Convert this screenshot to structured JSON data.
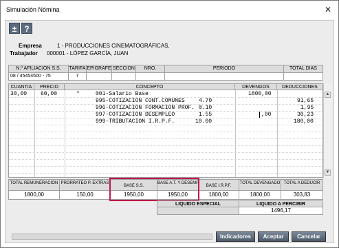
{
  "window": {
    "title": "Simulación Nómina",
    "close_glyph": "✕"
  },
  "toolbar": {
    "plusminus": "±",
    "help": "?"
  },
  "header": {
    "empresa_label": "Empresa",
    "empresa_value": "1  - PRODUCCIONES CINEMATOGRÁFICAS,",
    "trabajador_label": "Trabajador",
    "trabajador_value": "000001 - LÓPEZ GARCÍA, JUAN"
  },
  "afiliacion": {
    "headers": [
      "N.º AFILIACION S.S.",
      "TARIFA",
      "EPIGRAFE",
      "SECCION",
      "NRO.",
      "PERIODO",
      "TOTAL DIAS"
    ],
    "values": [
      "08 / 45454500 - 75",
      "7",
      "",
      "",
      "",
      "",
      ""
    ]
  },
  "lines": {
    "headers": [
      "CUANTIA",
      "PRECIO",
      "CONCEPTO",
      "DEVENGOS",
      "DEDUCCIONES"
    ],
    "rows": [
      {
        "cuantia": "30,00",
        "precio": "60,00",
        "mark": "*",
        "concepto": "001-Salario Base",
        "pct": "",
        "devengos": "1800,00",
        "deducciones": ""
      },
      {
        "cuantia": "",
        "precio": "",
        "mark": "",
        "concepto": "995-COTIZACION CONT.COMUNES",
        "pct": "4.70",
        "devengos": "",
        "deducciones": "91,65"
      },
      {
        "cuantia": "",
        "precio": "",
        "mark": "",
        "concepto": "996-COTIZACION FORMACION PROF.",
        "pct": "0.10",
        "devengos": "",
        "deducciones": "1,95"
      },
      {
        "cuantia": "",
        "precio": "",
        "mark": "",
        "concepto": "997-COTIZACION DESEMPLEO",
        "pct": "1.55",
        "devengos": ",00",
        "deducciones": "30,23"
      },
      {
        "cuantia": "",
        "precio": "",
        "mark": "",
        "concepto": "999-TRIBUTACION I.R.P.F.",
        "pct": "10.00",
        "devengos": "",
        "deducciones": "180,00"
      }
    ]
  },
  "totals": {
    "headers": [
      "TOTAL REMUNERACION",
      "PRORRATEO P. EXTRAS",
      "BASE S.S.",
      "BASE A.T. Y DESEMPLEO",
      "BASE I.R.P.F.",
      "TOTAL DEVENGADO",
      "TOTAL A DEDUCIR"
    ],
    "values": [
      "1800,00",
      "150,00",
      "1950,00",
      "1950,00",
      "1800,00",
      "1800,00",
      "303,83"
    ]
  },
  "liquido": {
    "especial_label": "LIQUIDO ESPECIAL",
    "especial_value": "",
    "percibir_label": "LIQUIDO A PERCIBIR",
    "percibir_value": "1496,17"
  },
  "buttons": {
    "indicadores": "Indicadores",
    "aceptar": "Aceptar",
    "cancelar": "Cancelar"
  },
  "colors": {
    "highlight": "#c0184a",
    "button": "#5b6b7e"
  }
}
